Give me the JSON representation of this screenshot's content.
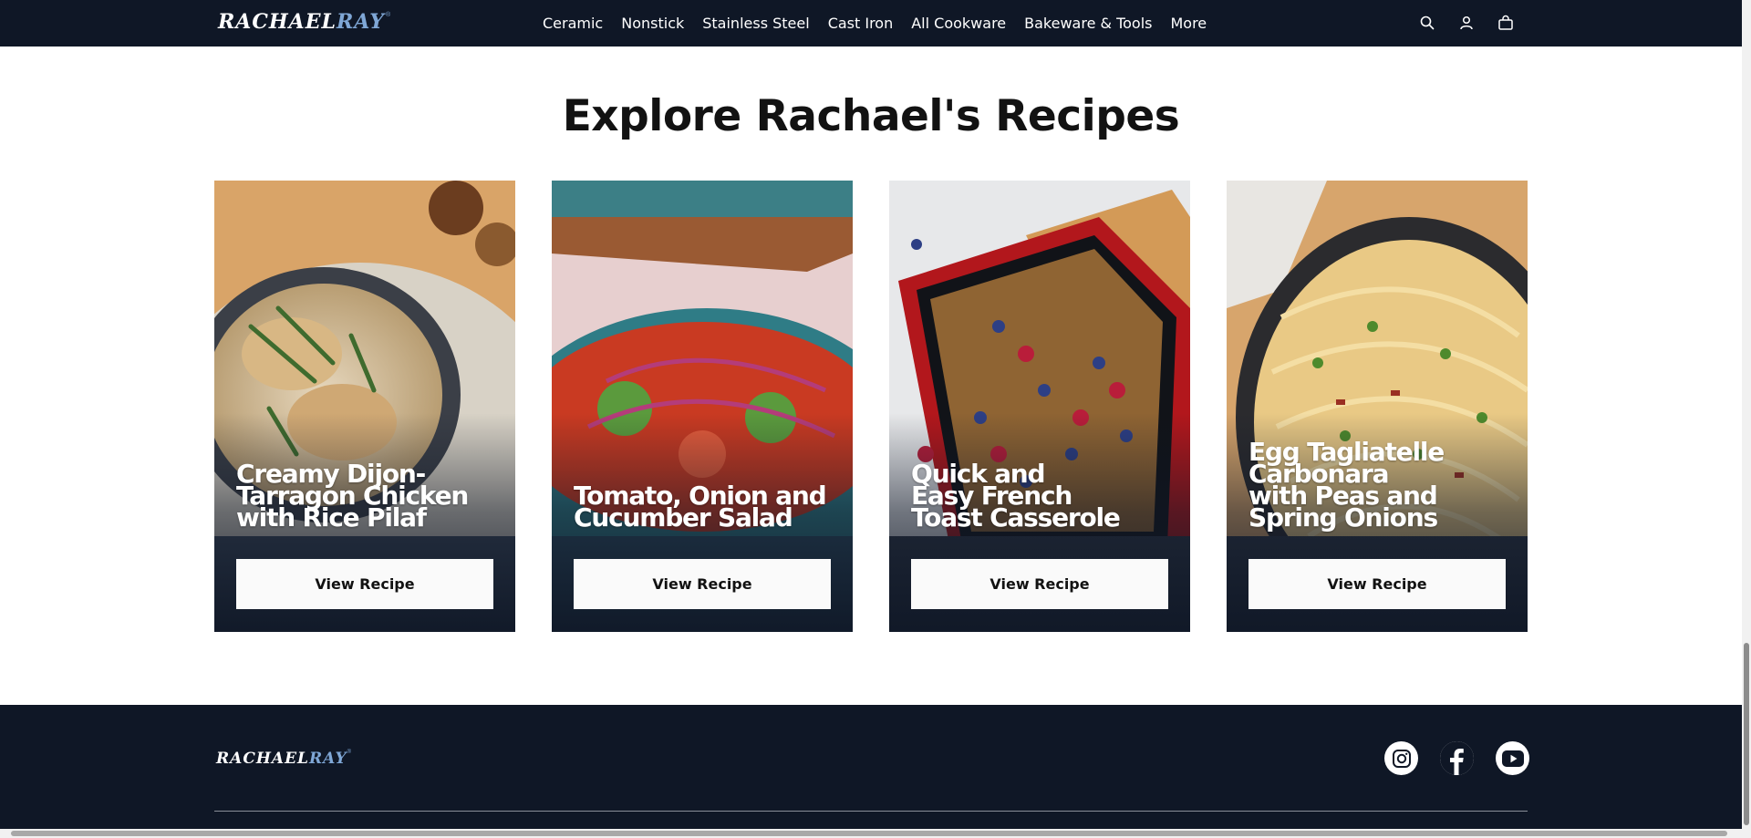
{
  "header": {
    "logo": {
      "text_main": "RACHAEL",
      "text_accent": "RAY",
      "mark": "®"
    },
    "nav": [
      "Ceramic",
      "Nonstick",
      "Stainless Steel",
      "Cast Iron",
      "All Cookware",
      "Bakeware & Tools",
      "More"
    ],
    "icons": [
      "search-icon",
      "account-icon",
      "cart-icon"
    ]
  },
  "section": {
    "title": "Explore Rachael's Recipes"
  },
  "recipes": [
    {
      "title": "Creamy Dijon-Tarragon Chicken with Rice Pilaf",
      "lines": [
        "Creamy Dijon-",
        "Tarragon Chicken",
        "with Rice Pilaf"
      ],
      "button": "View Recipe"
    },
    {
      "title": "Tomato, Onion and Cucumber Salad",
      "lines": [
        "Tomato, Onion and",
        "Cucumber Salad"
      ],
      "button": "View Recipe"
    },
    {
      "title": "Quick and Easy French Toast Casserole",
      "lines": [
        "Quick and",
        "Easy French",
        "Toast Casserole"
      ],
      "button": "View Recipe"
    },
    {
      "title": "Egg Tagliatelle Carbonara with Peas and Spring Onions",
      "lines": [
        "Egg Tagliatelle",
        "Carbonara",
        "with Peas and",
        "Spring Onions"
      ],
      "button": "View Recipe"
    }
  ],
  "footer": {
    "logo": {
      "text_main": "RACHAEL",
      "text_accent": "RAY",
      "mark": "®"
    },
    "social": [
      "instagram-icon",
      "facebook-icon",
      "youtube-icon"
    ]
  },
  "colors": {
    "navy": "#0f1726",
    "accent_blue": "#7fa7d6",
    "button_bg": "#fafafa"
  }
}
